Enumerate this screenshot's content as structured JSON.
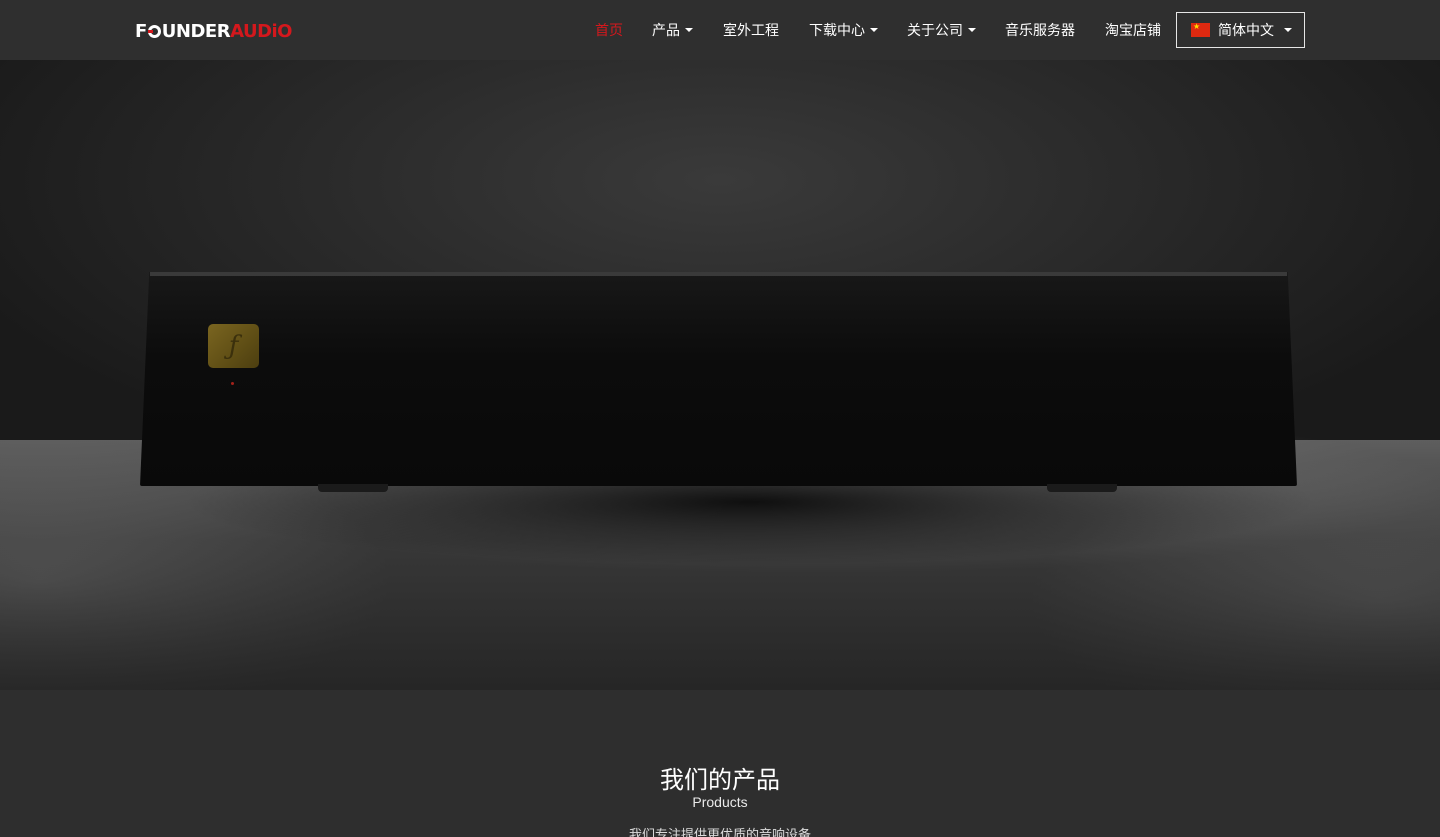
{
  "brand": {
    "part1": "F",
    "part2": "UNDER",
    "part3": "AUDiO"
  },
  "nav": {
    "items": [
      {
        "label": "首页",
        "active": true,
        "dropdown": false
      },
      {
        "label": "产品",
        "active": false,
        "dropdown": true
      },
      {
        "label": "室外工程",
        "active": false,
        "dropdown": false
      },
      {
        "label": "下载中心",
        "active": false,
        "dropdown": true
      },
      {
        "label": "关于公司",
        "active": false,
        "dropdown": true
      },
      {
        "label": "音乐服务器",
        "active": false,
        "dropdown": false
      },
      {
        "label": "淘宝店铺",
        "active": false,
        "dropdown": false
      }
    ],
    "language": "简体中文"
  },
  "products": {
    "title": "我们的产品",
    "subtitle": "Products",
    "description": "我们专注提供更优质的音响设备"
  },
  "colors": {
    "accent": "#d4181d",
    "navbar": "#2f2f2f",
    "section_bg": "#2e2e2e"
  },
  "icons": {
    "language_flag": "china-flag-icon",
    "dropdown": "caret-down-icon"
  }
}
